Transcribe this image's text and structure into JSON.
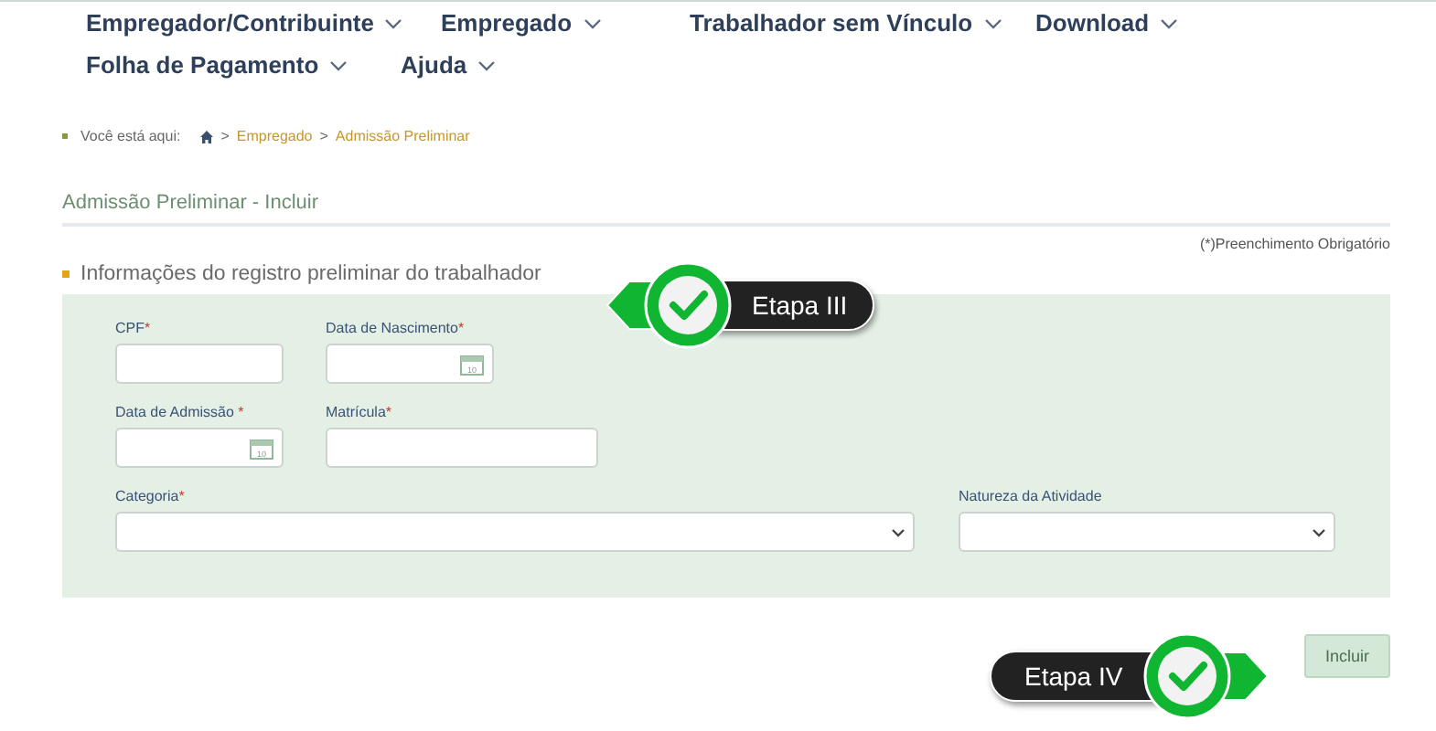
{
  "nav": {
    "rows": [
      [
        {
          "label": "Empregador/Contribuinte"
        },
        {
          "label": "Empregado"
        },
        {
          "label": "Trabalhador sem Vínculo"
        },
        {
          "label": "Download"
        }
      ],
      [
        {
          "label": "Folha de Pagamento"
        },
        {
          "label": "Ajuda"
        }
      ]
    ]
  },
  "breadcrumb": {
    "label": "Você está aqui:",
    "crumbs": [
      {
        "kind": "home"
      },
      {
        "kind": "separator",
        "text": ">"
      },
      {
        "kind": "link",
        "text": "Empregado"
      },
      {
        "kind": "separator",
        "text": ">"
      },
      {
        "kind": "link",
        "text": "Admissão Preliminar"
      }
    ]
  },
  "page_title": "Admissão Preliminar - Incluir",
  "required_note": "(*)Preenchimento Obrigatório",
  "section": {
    "heading": "Informações do registro preliminar do trabalhador",
    "rows": [
      [
        {
          "label": "CPF",
          "required_mark": "*",
          "kind": "text"
        },
        {
          "label": "Data de Nascimento",
          "required_mark": "*",
          "kind": "date",
          "calendar_day": "10"
        }
      ],
      [
        {
          "label": "Data de Admissão ",
          "required_mark": "*",
          "kind": "date",
          "calendar_day": "10"
        },
        {
          "label": "Matrícula",
          "required_mark": "*",
          "kind": "text"
        }
      ],
      [
        {
          "label": "Categoria",
          "required_mark": "*",
          "kind": "select"
        },
        {
          "label": "Natureza da Atividade",
          "kind": "select"
        }
      ]
    ]
  },
  "submit_button": "Incluir",
  "callouts": [
    {
      "text": "Etapa III"
    },
    {
      "text": "Etapa IV"
    }
  ]
}
